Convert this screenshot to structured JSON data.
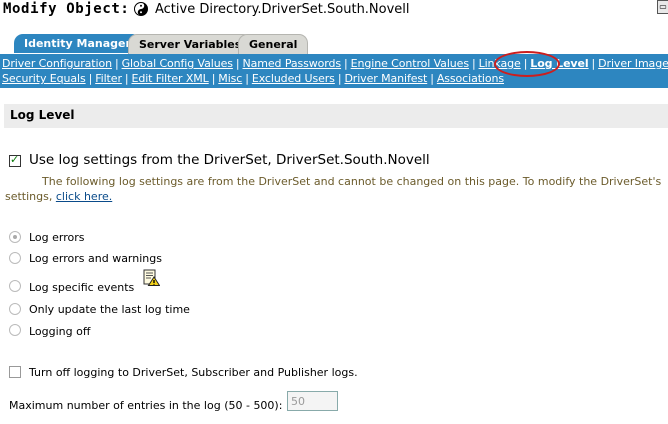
{
  "header": {
    "label": "Modify Object:",
    "object_name": "Active Directory.DriverSet.South.Novell"
  },
  "tabs": [
    {
      "label": "Identity Manager",
      "active": true
    },
    {
      "label": "Server Variables",
      "active": false
    },
    {
      "label": "General",
      "active": false
    }
  ],
  "links_row1": [
    "Driver Configuration",
    "Global Config Values",
    "Named Passwords",
    "Engine Control Values",
    "Linkage",
    "Log Level",
    "Driver Image"
  ],
  "links_row2": [
    "Security Equals",
    "Filter",
    "Edit Filter XML",
    "Misc",
    "Excluded Users",
    "Driver Manifest",
    "Associations"
  ],
  "separator": "|",
  "section": {
    "title": "Log Level"
  },
  "use_driverset": {
    "label": "Use log settings from the DriverSet, DriverSet.South.Novell",
    "checked": true,
    "note_line1": "The following log settings are from the DriverSet and cannot be changed on this page. To modify the DriverSet's",
    "note_line2_prefix": "settings,",
    "note_link": "click here."
  },
  "log_options": [
    {
      "label": "Log errors",
      "selected": true
    },
    {
      "label": "Log errors and warnings",
      "selected": false
    },
    {
      "label": "Log specific events",
      "selected": false
    },
    {
      "label": "Only update the last log time",
      "selected": false
    },
    {
      "label": "Logging off",
      "selected": false
    }
  ],
  "turn_off": {
    "label": "Turn off logging to DriverSet, Subscriber and Publisher logs.",
    "checked": false
  },
  "max_entries": {
    "label": "Maximum number of entries in the log (50 - 500):",
    "value": "50"
  },
  "colors": {
    "accent": "#2d86c0",
    "highlight_circle": "#cc1e1e",
    "note_text": "#6b5b2b"
  },
  "icons": {
    "object": "yin-yang-icon",
    "events": "notepad-warning-icon",
    "corner": "window-icon"
  }
}
